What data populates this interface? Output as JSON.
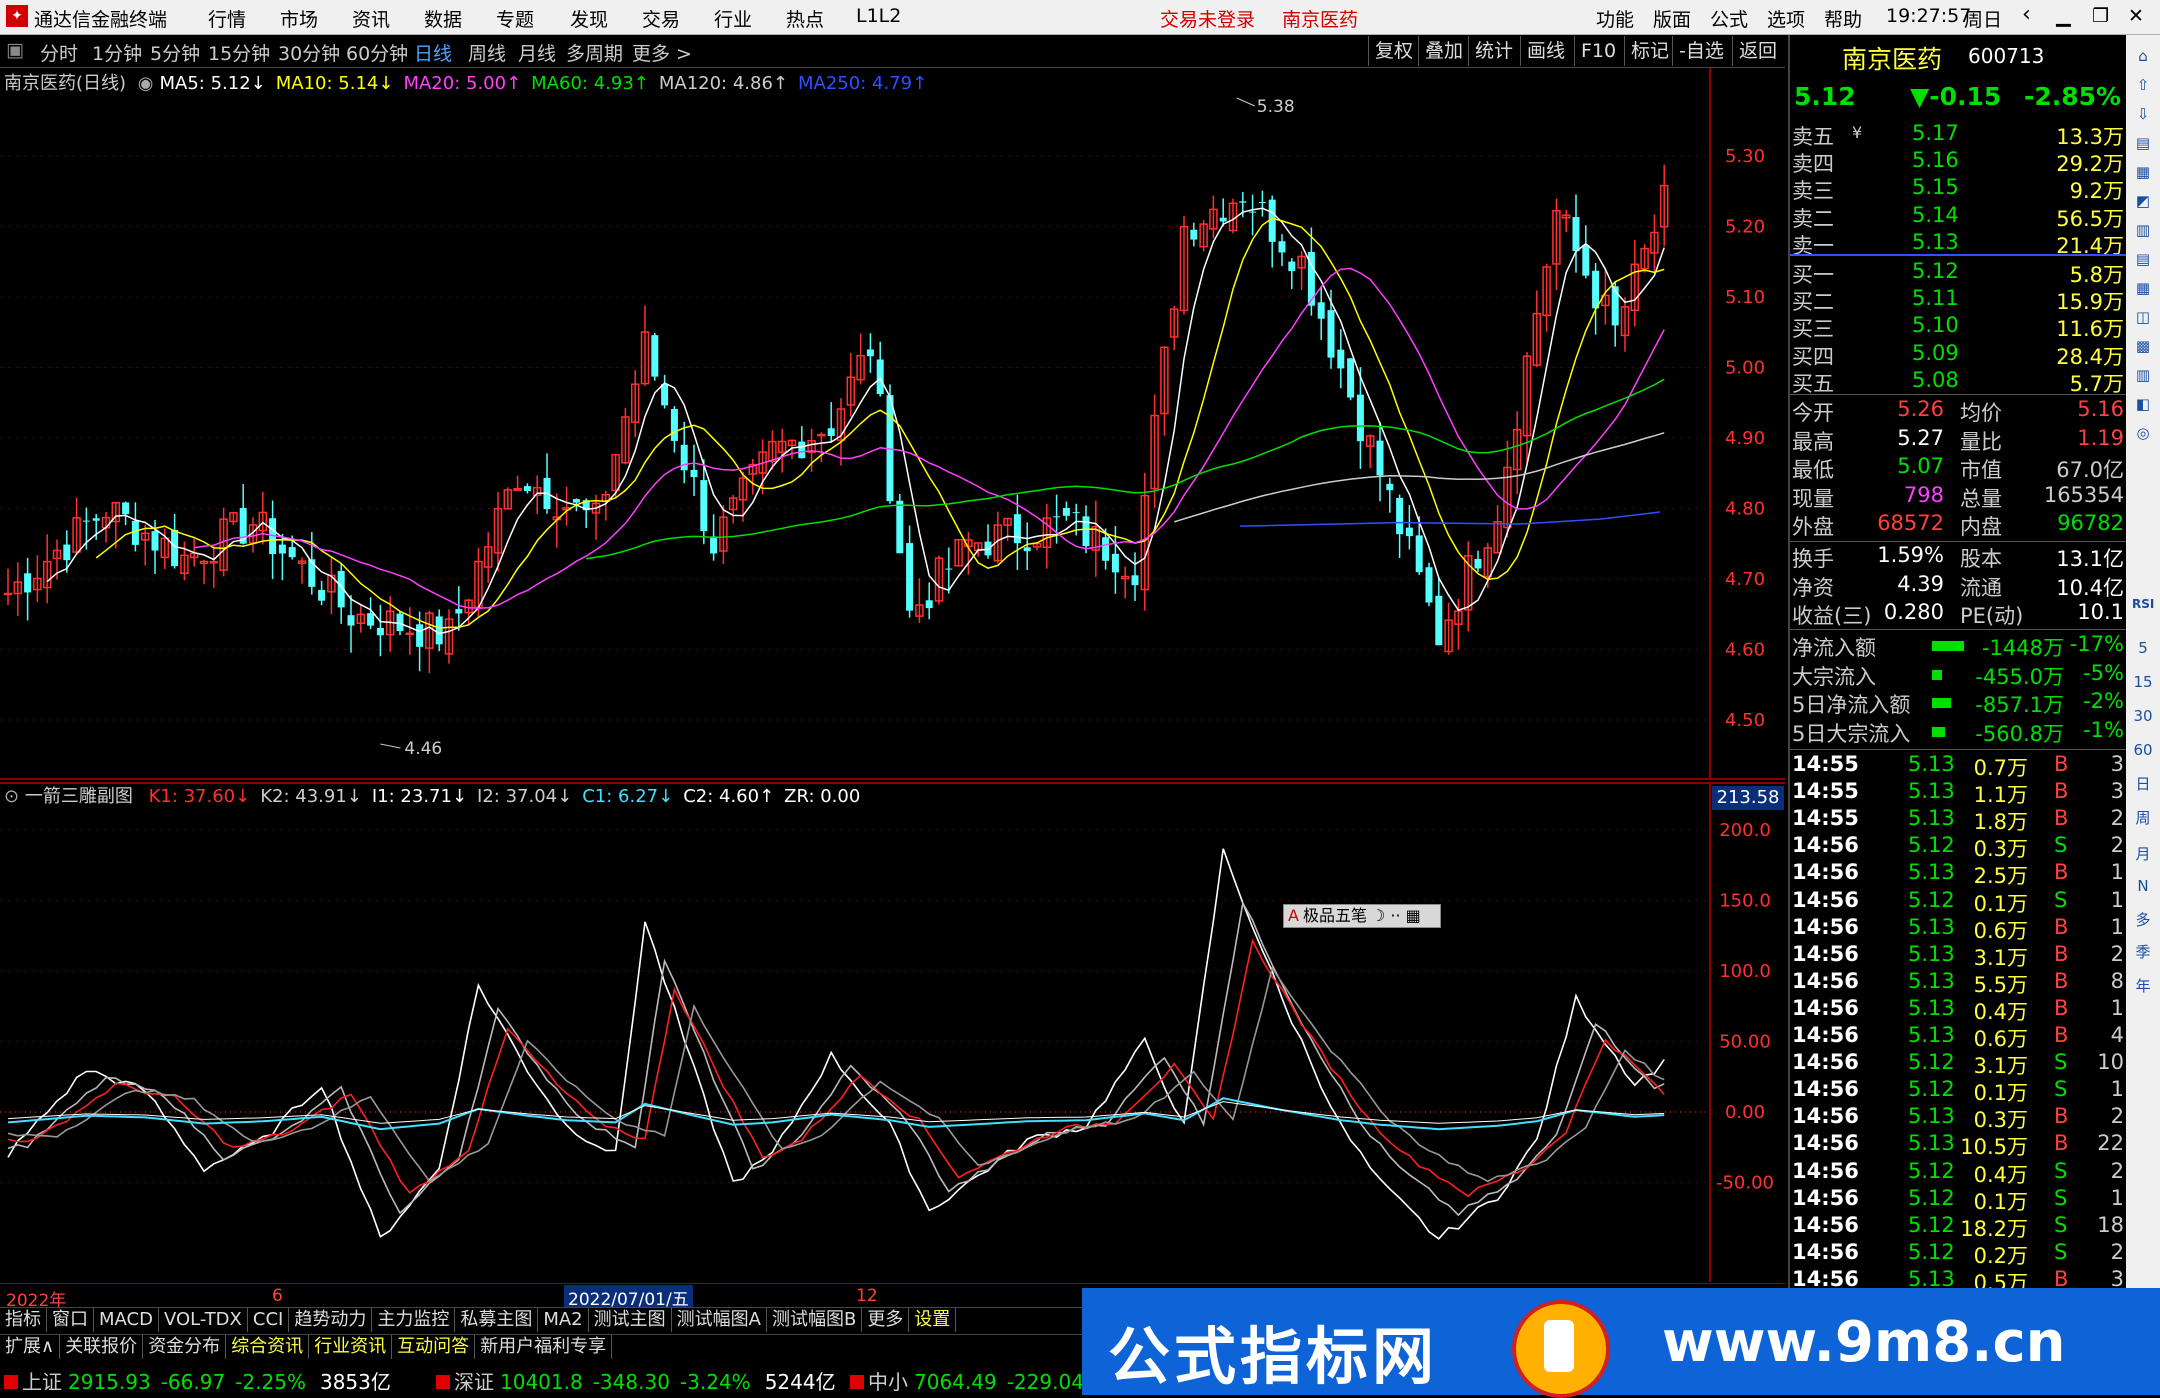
{
  "titlebar": {
    "app_title": "通达信金融终端",
    "menus": [
      "行情",
      "市场",
      "资讯",
      "数据",
      "专题",
      "发现",
      "交易",
      "行业",
      "热点",
      "L1L2"
    ],
    "login_status": "交易未登录",
    "stock_title": "南京医药",
    "right_menus": [
      "功能",
      "版面",
      "公式",
      "选项",
      "帮助"
    ],
    "time": "19:27:57",
    "weekday": "周日"
  },
  "periods": [
    "分时",
    "1分钟",
    "5分钟",
    "15分钟",
    "30分钟",
    "60分钟",
    "日线",
    "周线",
    "月线",
    "多周期",
    "更多 >"
  ],
  "active_period": "日线",
  "tools": [
    "复权",
    "叠加",
    "统计",
    "画线",
    "F10",
    "标记",
    "-自选",
    "返回"
  ],
  "main_legend": {
    "name": "南京医药(日线)",
    "items": [
      {
        "label": "MA5: 5.12↓",
        "color": "#ffffff"
      },
      {
        "label": "MA10: 5.14↓",
        "color": "#ffff00"
      },
      {
        "label": "MA20: 5.00↑",
        "color": "#ff40ff"
      },
      {
        "label": "MA60: 4.93↑",
        "color": "#00e000"
      },
      {
        "label": "MA120: 4.86↑",
        "color": "#cccccc"
      },
      {
        "label": "MA250: 4.79↑",
        "color": "#3050ff"
      }
    ]
  },
  "main_axis": [
    "5.30",
    "5.20",
    "5.10",
    "5.00",
    "4.90",
    "4.80",
    "4.70",
    "4.60",
    "4.50"
  ],
  "main_marks": {
    "high": "5.38",
    "low": "4.46"
  },
  "sub_legend": {
    "name": "一箭三雕副图",
    "items": [
      {
        "label": "K1: 37.60↓",
        "color": "#ff3030"
      },
      {
        "label": "K2: 43.91↓",
        "color": "#cccccc"
      },
      {
        "label": "I1: 23.71↓",
        "color": "#ffffff"
      },
      {
        "label": "I2: 37.04↓",
        "color": "#cccccc"
      },
      {
        "label": "C1: 6.27↓",
        "color": "#40e0ff"
      },
      {
        "label": "C2: 4.60↑",
        "color": "#ffffff"
      },
      {
        "label": "ZR: 0.00",
        "color": "#ffffff"
      }
    ]
  },
  "sub_top_value": "213.58",
  "sub_axis": [
    "200.0",
    "150.0",
    "100.0",
    "50.00",
    "0.00",
    "-50.00"
  ],
  "brush_tool": "极品五笔",
  "date_axis": {
    "left": "2022年",
    "mid1": "6",
    "cursor": "2022/07/01/五",
    "mid2": "12"
  },
  "bottom_tabs_row1": [
    "指标",
    "窗口",
    "MACD",
    "VOL-TDX",
    "CCI",
    "趋势动力",
    "主力监控",
    "私募主图",
    "MA2",
    "测试主图",
    "测试幅图A",
    "测试幅图B",
    "更多",
    "设置"
  ],
  "bottom_tabs_row2": [
    "扩展∧",
    "关联报价",
    "资金分布",
    "综合资讯",
    "行业资讯",
    "互动问答",
    "新用户福利专享"
  ],
  "status": [
    {
      "label": "上证",
      "value": "2915.93",
      "change": "-66.97",
      "pct": "-2.25%",
      "amount": "3853亿"
    },
    {
      "label": "深证",
      "value": "10401.8",
      "change": "-348.30",
      "pct": "-3.24%",
      "amount": "5244亿"
    },
    {
      "label": "中小",
      "value": "7064.49",
      "change": "-229.04",
      "pct": "",
      "amount": ""
    }
  ],
  "quote": {
    "name": "南京医药",
    "code": "600713",
    "price": "5.12",
    "change": "▼-0.15",
    "pct": "-2.85%",
    "asks": [
      {
        "label": "卖五",
        "price": "5.17",
        "vol": "13.3万"
      },
      {
        "label": "卖四",
        "price": "5.16",
        "vol": "29.2万"
      },
      {
        "label": "卖三",
        "price": "5.15",
        "vol": "9.2万"
      },
      {
        "label": "卖二",
        "price": "5.14",
        "vol": "56.5万"
      },
      {
        "label": "卖一",
        "price": "5.13",
        "vol": "21.4万"
      }
    ],
    "bids": [
      {
        "label": "买一",
        "price": "5.12",
        "vol": "5.8万"
      },
      {
        "label": "买二",
        "price": "5.11",
        "vol": "15.9万"
      },
      {
        "label": "买三",
        "price": "5.10",
        "vol": "11.6万"
      },
      {
        "label": "买四",
        "price": "5.09",
        "vol": "28.4万"
      },
      {
        "label": "买五",
        "price": "5.08",
        "vol": "5.7万"
      }
    ],
    "stats": [
      {
        "l1": "今开",
        "v1": "5.26",
        "c1": "#ff4040",
        "l2": "均价",
        "v2": "5.16",
        "c2": "#ff4040"
      },
      {
        "l1": "最高",
        "v1": "5.27",
        "c1": "#ffffff",
        "l2": "量比",
        "v2": "1.19",
        "c2": "#ff4040"
      },
      {
        "l1": "最低",
        "v1": "5.07",
        "c1": "#00e000",
        "l2": "市值",
        "v2": "67.0亿",
        "c2": "#cccccc"
      },
      {
        "l1": "现量",
        "v1": "798",
        "c1": "#ff40ff",
        "l2": "总量",
        "v2": "165354",
        "c2": "#cccccc"
      },
      {
        "l1": "外盘",
        "v1": "68572",
        "c1": "#ff4040",
        "l2": "内盘",
        "v2": "96782",
        "c2": "#00e000"
      }
    ],
    "stats2": [
      {
        "l1": "换手",
        "v1": "1.59%",
        "l2": "股本",
        "v2": "13.1亿"
      },
      {
        "l1": "净资",
        "v1": "4.39",
        "l2": "流通",
        "v2": "10.4亿"
      },
      {
        "l1": "收益(三)",
        "v1": "0.280",
        "l2": "PE(动)",
        "v2": "10.1"
      }
    ],
    "flows": [
      {
        "label": "净流入额",
        "value": "-1448万",
        "pct": "-17%",
        "bar": 0.85
      },
      {
        "label": "大宗流入",
        "value": "-455.0万",
        "pct": "-5%",
        "bar": 0.25
      },
      {
        "label": "5日净流入额",
        "value": "-857.1万",
        "pct": "-2%",
        "bar": 0.5
      },
      {
        "label": "5日大宗流入",
        "value": "-560.8万",
        "pct": "-1%",
        "bar": 0.35
      }
    ],
    "ticks": [
      {
        "t": "14:55",
        "p": "5.13",
        "v": "0.7万",
        "s": "B",
        "n": "3"
      },
      {
        "t": "14:55",
        "p": "5.13",
        "v": "1.1万",
        "s": "B",
        "n": "3"
      },
      {
        "t": "14:55",
        "p": "5.13",
        "v": "1.8万",
        "s": "B",
        "n": "2"
      },
      {
        "t": "14:56",
        "p": "5.12",
        "v": "0.3万",
        "s": "S",
        "n": "2"
      },
      {
        "t": "14:56",
        "p": "5.13",
        "v": "2.5万",
        "s": "B",
        "n": "1"
      },
      {
        "t": "14:56",
        "p": "5.12",
        "v": "0.1万",
        "s": "S",
        "n": "1"
      },
      {
        "t": "14:56",
        "p": "5.13",
        "v": "0.6万",
        "s": "B",
        "n": "1"
      },
      {
        "t": "14:56",
        "p": "5.13",
        "v": "3.1万",
        "s": "B",
        "n": "2"
      },
      {
        "t": "14:56",
        "p": "5.13",
        "v": "5.5万",
        "s": "B",
        "n": "8"
      },
      {
        "t": "14:56",
        "p": "5.13",
        "v": "0.4万",
        "s": "B",
        "n": "1"
      },
      {
        "t": "14:56",
        "p": "5.13",
        "v": "0.6万",
        "s": "B",
        "n": "4"
      },
      {
        "t": "14:56",
        "p": "5.12",
        "v": "3.1万",
        "s": "S",
        "n": "10"
      },
      {
        "t": "14:56",
        "p": "5.12",
        "v": "0.1万",
        "s": "S",
        "n": "1"
      },
      {
        "t": "14:56",
        "p": "5.13",
        "v": "0.3万",
        "s": "B",
        "n": "2"
      },
      {
        "t": "14:56",
        "p": "5.13",
        "v": "10.5万",
        "s": "B",
        "n": "22"
      },
      {
        "t": "14:56",
        "p": "5.12",
        "v": "0.4万",
        "s": "S",
        "n": "2"
      },
      {
        "t": "14:56",
        "p": "5.12",
        "v": "0.1万",
        "s": "S",
        "n": "1"
      },
      {
        "t": "14:56",
        "p": "5.12",
        "v": "18.2万",
        "s": "S",
        "n": "18"
      },
      {
        "t": "14:56",
        "p": "5.12",
        "v": "0.2万",
        "s": "S",
        "n": "2"
      },
      {
        "t": "14:56",
        "p": "5.13",
        "v": "0.5万",
        "s": "B",
        "n": "3"
      }
    ]
  },
  "sidebar_labels": [
    "RSI",
    "5",
    "15",
    "30",
    "60",
    "日",
    "周",
    "月",
    "N",
    "多",
    "季",
    "年"
  ],
  "banner": {
    "text": "公式指标网",
    "url": "www.9m8.cn"
  }
}
